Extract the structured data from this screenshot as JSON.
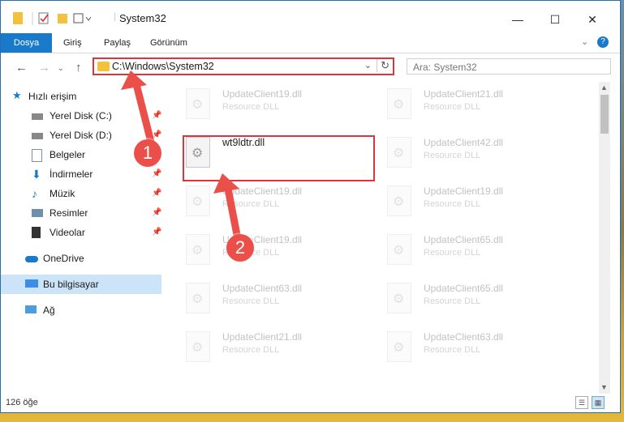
{
  "window": {
    "title": "System32",
    "controls": {
      "minimize": "—",
      "maximize": "☐",
      "close": "✕"
    }
  },
  "ribbon": {
    "tabs": [
      "Dosya",
      "Giriş",
      "Paylaş",
      "Görünüm"
    ],
    "expand_icon": "chevron-down-icon",
    "help_icon": "help-icon"
  },
  "nav": {
    "address": "C:\\Windows\\System32",
    "search_placeholder": "Ara: System32"
  },
  "sidebar": {
    "quick_access": "Hızlı erişim",
    "items": [
      {
        "label": "Yerel Disk (C:)",
        "icon": "drive-icon",
        "pinned": true
      },
      {
        "label": "Yerel Disk (D:)",
        "icon": "drive-icon",
        "pinned": true
      },
      {
        "label": "Belgeler",
        "icon": "documents-icon",
        "pinned": true
      },
      {
        "label": "İndirmeler",
        "icon": "download-icon",
        "pinned": true
      },
      {
        "label": "Müzik",
        "icon": "music-icon",
        "pinned": true
      },
      {
        "label": "Resimler",
        "icon": "pictures-icon",
        "pinned": true
      },
      {
        "label": "Videolar",
        "icon": "videos-icon",
        "pinned": true
      }
    ],
    "onedrive": "OneDrive",
    "this_pc": "Bu bilgisayar",
    "network": "Ağ"
  },
  "files": [
    {
      "name": "UpdateClient19.dll",
      "type": "Resource DLL",
      "faded": true
    },
    {
      "name": "UpdateClient21.dll",
      "type": "Resource DLL",
      "faded": true
    },
    {
      "name": "wt9ldtr.dll",
      "type": "",
      "faded": false
    },
    {
      "name": "UpdateClient42.dll",
      "type": "Resource DLL",
      "faded": true
    },
    {
      "name": "UpdateClient19.dll",
      "type": "Resource DLL",
      "faded": true
    },
    {
      "name": "UpdateClient19.dll",
      "type": "Resource DLL",
      "faded": true
    },
    {
      "name": "UpdateClient19.dll",
      "type": "Resource DLL",
      "faded": true
    },
    {
      "name": "UpdateClient65.dll",
      "type": "Resource DLL",
      "faded": true
    },
    {
      "name": "UpdateClient63.dll",
      "type": "Resource DLL",
      "faded": true
    },
    {
      "name": "UpdateClient65.dll",
      "type": "Resource DLL",
      "faded": true
    },
    {
      "name": "UpdateClient21.dll",
      "type": "Resource DLL",
      "faded": true
    },
    {
      "name": "UpdateClient63.dll",
      "type": "Resource DLL",
      "faded": true
    }
  ],
  "status": {
    "item_count": "126 öğe"
  },
  "annotations": {
    "badge1": "1",
    "badge2": "2",
    "accent": "#ea4f4a"
  }
}
